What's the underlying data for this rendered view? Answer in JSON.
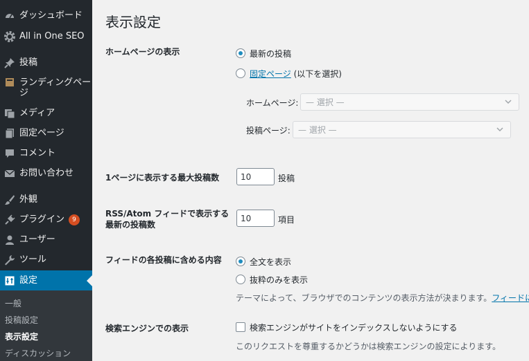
{
  "sidebar": {
    "items": [
      {
        "label": "ダッシュボード",
        "icon": "dashboard-icon"
      },
      {
        "label": "All in One SEO",
        "icon": "gear-icon"
      },
      {
        "label": "投稿",
        "icon": "pin-icon"
      },
      {
        "label": "ランディングペー\nジ",
        "icon": "landing-page-icon"
      },
      {
        "label": "メディア",
        "icon": "media-icon"
      },
      {
        "label": "固定ページ",
        "icon": "page-icon"
      },
      {
        "label": "コメント",
        "icon": "comment-icon"
      },
      {
        "label": "お問い合わせ",
        "icon": "mail-icon"
      },
      {
        "label": "外観",
        "icon": "brush-icon"
      },
      {
        "label": "プラグイン",
        "icon": "plugin-icon",
        "badge": "9"
      },
      {
        "label": "ユーザー",
        "icon": "user-icon"
      },
      {
        "label": "ツール",
        "icon": "wrench-icon"
      },
      {
        "label": "設定",
        "icon": "settings-icon"
      }
    ],
    "submenu": [
      "一般",
      "投稿設定",
      "表示設定",
      "ディスカッション"
    ]
  },
  "page": {
    "title": "表示設定",
    "homepage": {
      "label": "ホームページの表示",
      "opt_latest": "最新の投稿",
      "opt_static_link": "固定ページ",
      "opt_static_suffix": " (以下を選択)",
      "front_label": "ホームページ:",
      "front_value": "— 選択 —",
      "posts_label": "投稿ページ:",
      "posts_value": "— 選択 —"
    },
    "per_page": {
      "label": "1ページに表示する最大投稿数",
      "value": "10",
      "unit": "投稿"
    },
    "feed_count": {
      "label_line1": "RSS/Atom フィードで表示する",
      "label_line2": "最新の投稿数",
      "value": "10",
      "unit": "項目"
    },
    "feed_content": {
      "label": "フィードの各投稿に含める内容",
      "opt_full": "全文を表示",
      "opt_summary": "抜粋のみを表示",
      "desc": "テーマによって、ブラウザでのコンテンツの表示方法が決まります。",
      "desc_link": "フィードに"
    },
    "search": {
      "label": "検索エンジンでの表示",
      "checkbox_label": "検索エンジンがサイトをインデックスしないようにする",
      "desc": "このリクエストを尊重するかどうかは検索エンジンの設定によります。"
    }
  },
  "colors": {
    "sidebar_bg": "#23282d",
    "accent": "#0073aa",
    "badge": "#d54e21"
  }
}
